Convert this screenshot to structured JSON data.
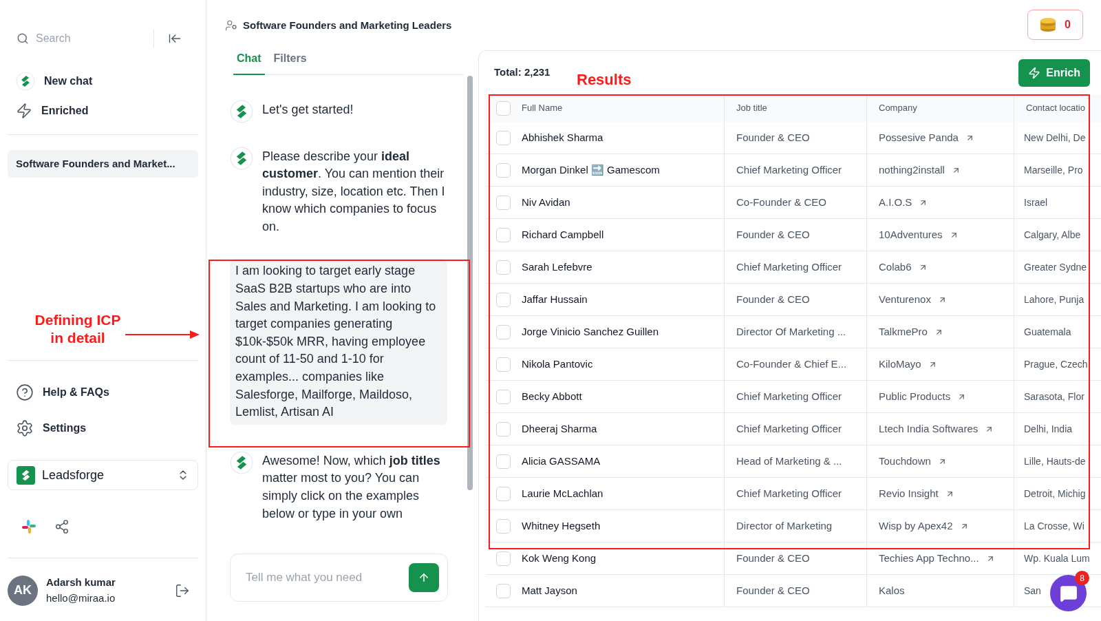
{
  "sidebar": {
    "search": {
      "placeholder": "Search"
    },
    "nav": [
      {
        "kind": "logo",
        "label": "New chat"
      },
      {
        "kind": "bolt",
        "label": "Enriched"
      }
    ],
    "chats": [
      {
        "label": "Software Founders and Market...",
        "selected": true
      }
    ],
    "bottom_nav": [
      {
        "kind": "help",
        "label": "Help & FAQs"
      },
      {
        "kind": "settings",
        "label": "Settings"
      }
    ],
    "workspace": "Leadsforge",
    "user": {
      "initials": "AK",
      "name": "Adarsh kumar",
      "email": "hello@miraa.io"
    }
  },
  "chat": {
    "title": "Software Founders and Marketing Leaders",
    "tabs": [
      {
        "label": "Chat",
        "selected": true
      },
      {
        "label": "Filters",
        "selected": false
      }
    ],
    "messages": [
      {
        "kind": "bot",
        "text": "Let's get started!"
      },
      {
        "kind": "bot",
        "text": "Please describe your **ideal customer**. You can mention their industry, size, location etc. Then I know which companies to focus on."
      },
      {
        "kind": "user",
        "text": "I am looking to target early stage SaaS B2B startups who are into Sales and Marketing. I am looking to target companies generating $10k-$50k MRR, having employee count of 11-50 and 1-10 for examples... companies like Salesforge, Mailforge, Maildoso, Lemlist, Artisan AI"
      },
      {
        "kind": "bot",
        "text": "Awesome! Now, which **job titles** matter most to you? You can simply click on the examples below or type in your own"
      }
    ],
    "input": {
      "placeholder": "Tell me what you need"
    }
  },
  "credits": "0",
  "results": {
    "total": "Total: 2,231",
    "enrich_button": "Enrich",
    "columns": [
      "Full Name",
      "Job title",
      "Company",
      "Contact locatio"
    ],
    "header_checked": false,
    "rows": [
      {
        "checked": false,
        "name": "Abhishek Sharma",
        "title": "Founder & CEO",
        "company": "Possesive Panda",
        "link": true,
        "location": "New Delhi, De"
      },
      {
        "checked": false,
        "name": "Morgan Dinkel 🔜 Gamescom",
        "title": "Chief Marketing Officer",
        "company": "nothing2install",
        "link": true,
        "location": "Marseille, Pro"
      },
      {
        "checked": false,
        "name": "Niv Avidan",
        "title": "Co-Founder & CEO",
        "company": "A.I.O.S",
        "link": true,
        "location": "Israel"
      },
      {
        "checked": false,
        "name": "Richard Campbell",
        "title": "Founder & CEO",
        "company": "10Adventures",
        "link": true,
        "location": "Calgary, Albe"
      },
      {
        "checked": false,
        "name": "Sarah Lefebvre",
        "title": "Chief Marketing Officer",
        "company": "Colab6",
        "link": true,
        "location": "Greater Sydne"
      },
      {
        "checked": false,
        "name": "Jaffar Hussain",
        "title": "Founder & CEO",
        "company": "Venturenox",
        "link": true,
        "location": "Lahore, Punja"
      },
      {
        "checked": false,
        "name": "Jorge Vinicio Sanchez Guillen",
        "title": "Director Of Marketing ...",
        "company": "TalkmePro",
        "link": true,
        "location": "Guatemala"
      },
      {
        "checked": false,
        "name": "Nikola Pantovic",
        "title": "Co-Founder & Chief E...",
        "company": "KiloMayo",
        "link": true,
        "location": "Prague, Czech"
      },
      {
        "checked": false,
        "name": "Becky Abbott",
        "title": "Chief Marketing Officer",
        "company": "Public Products",
        "link": true,
        "location": "Sarasota, Flor"
      },
      {
        "checked": false,
        "name": "Dheeraj Sharma",
        "title": "Chief Marketing Officer",
        "company": "Ltech India Softwares",
        "link": true,
        "location": "Delhi, India"
      },
      {
        "checked": false,
        "name": "Alicia GASSAMA",
        "title": "Head of Marketing & ...",
        "company": "Touchdown",
        "link": true,
        "location": "Lille, Hauts-de"
      },
      {
        "checked": false,
        "name": "Laurie McLachlan",
        "title": "Chief Marketing Officer",
        "company": "Revio Insight",
        "link": true,
        "location": "Detroit, Michig"
      },
      {
        "checked": false,
        "name": "Whitney Hegseth",
        "title": "Director of Marketing",
        "company": "Wisp by Apex42",
        "link": true,
        "location": "La Crosse, Wi"
      },
      {
        "checked": false,
        "name": "Kok Weng Kong",
        "title": "Founder & CEO",
        "company": "Techies App Techno...",
        "link": true,
        "location": "Wp. Kuala Lum"
      },
      {
        "checked": false,
        "name": "Matt Jayson",
        "title": "Founder & CEO",
        "company": "Kalos",
        "link": false,
        "location": "San"
      }
    ]
  },
  "support_badge": "8",
  "annotations": [
    {
      "kind": "arrow_label",
      "text": "Defining ICP in detail"
    },
    {
      "kind": "label",
      "text": "Results"
    }
  ]
}
